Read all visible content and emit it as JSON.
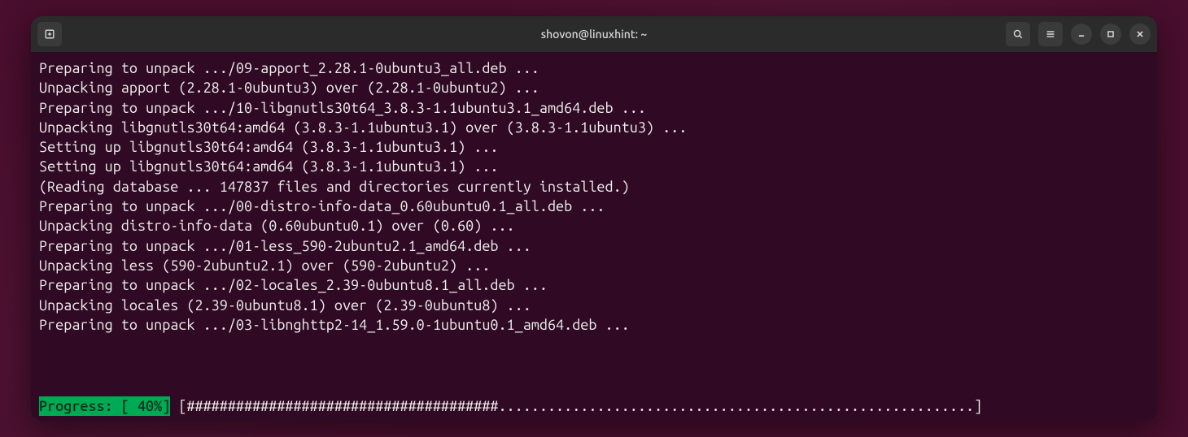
{
  "window": {
    "title": "shovon@linuxhint: ~"
  },
  "terminal": {
    "lines": [
      "Preparing to unpack .../09-apport_2.28.1-0ubuntu3_all.deb ...",
      "Unpacking apport (2.28.1-0ubuntu3) over (2.28.1-0ubuntu2) ...",
      "Preparing to unpack .../10-libgnutls30t64_3.8.3-1.1ubuntu3.1_amd64.deb ...",
      "Unpacking libgnutls30t64:amd64 (3.8.3-1.1ubuntu3.1) over (3.8.3-1.1ubuntu3) ...",
      "Setting up libgnutls30t64:amd64 (3.8.3-1.1ubuntu3.1) ...",
      "Setting up libgnutls30t64:amd64 (3.8.3-1.1ubuntu3.1) ...",
      "(Reading database ... 147837 files and directories currently installed.)",
      "Preparing to unpack .../00-distro-info-data_0.60ubuntu0.1_all.deb ...",
      "Unpacking distro-info-data (0.60ubuntu0.1) over (0.60) ...",
      "Preparing to unpack .../01-less_590-2ubuntu2.1_amd64.deb ...",
      "Unpacking less (590-2ubuntu2.1) over (590-2ubuntu2) ...",
      "Preparing to unpack .../02-locales_2.39-0ubuntu8.1_all.deb ...",
      "Unpacking locales (2.39-0ubuntu8.1) over (2.39-0ubuntu8) ...",
      "Preparing to unpack .../03-libnghttp2-14_1.59.0-1ubuntu0.1_amd64.deb ..."
    ],
    "progress": {
      "label": "Progress: [ 40%]",
      "percent": 40,
      "bar_width_chars": 96,
      "fill_char": "#",
      "empty_char": "."
    }
  },
  "colors": {
    "terminal_bg": "#300a24",
    "terminal_fg": "#eeeeec",
    "progress_bg": "#00aa55",
    "progress_fg": "#003018"
  }
}
